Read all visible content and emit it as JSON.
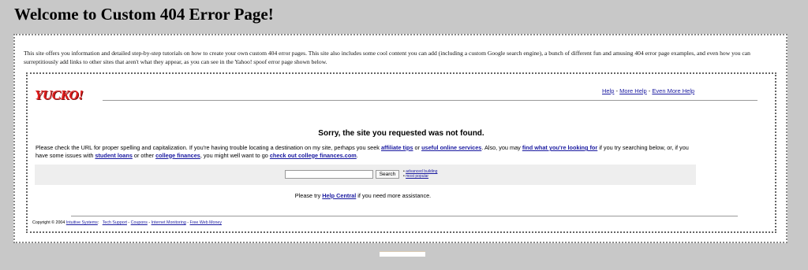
{
  "page": {
    "title": "Welcome to Custom 404 Error Page!",
    "intro": "This site offers you information and detailed step-by-step tutorials on how to create your own custom 404 error pages. This site also includes some cool content you can add (including a custom Google search engine), a bunch of different fun and amusing 404 error page examples, and even how you can surreptitiously add links to other sites that aren't what they appear, as you can see in the Yahoo! spoof error page shown below."
  },
  "spoof": {
    "logo": "YUCKO!",
    "help_links": [
      "Help",
      "More Help",
      "Even More Help"
    ],
    "separator": " - ",
    "error_title": "Sorry, the site you requested was not found.",
    "body": {
      "t1": "Please check the URL for proper spelling and capitalization. If you're having trouble locating a destination on my site, perhaps you seek ",
      "l1": "affiliate tips",
      "t2": " or ",
      "l2": "useful online services",
      "t3": ". Also, you may ",
      "l3": "find what you're looking for",
      "t4": " if you try searching below, or, if you have some issues with ",
      "l4": "student loans",
      "t5": " or other ",
      "l5": "college finances",
      "t6": ", you might well want to go ",
      "l6": "check out college finances.com",
      "t7": "."
    },
    "search": {
      "value": "",
      "button": "Search",
      "side_links": [
        "advanced building",
        "most popular"
      ]
    },
    "assist": {
      "before": "Please try ",
      "link": "Help Central",
      "after": " if you need more assistance."
    },
    "footer": {
      "copyright": "Copyright © 2004 ",
      "company": "Intuitive Systems",
      "colon": ":",
      "links": [
        "Tech Support",
        "Coupons",
        "Internet Monitoring",
        "Free Web Money"
      ]
    }
  },
  "colors": {
    "background": "#c8c8c8",
    "link": "#1a1aa0",
    "logo": "#e01e1e"
  }
}
